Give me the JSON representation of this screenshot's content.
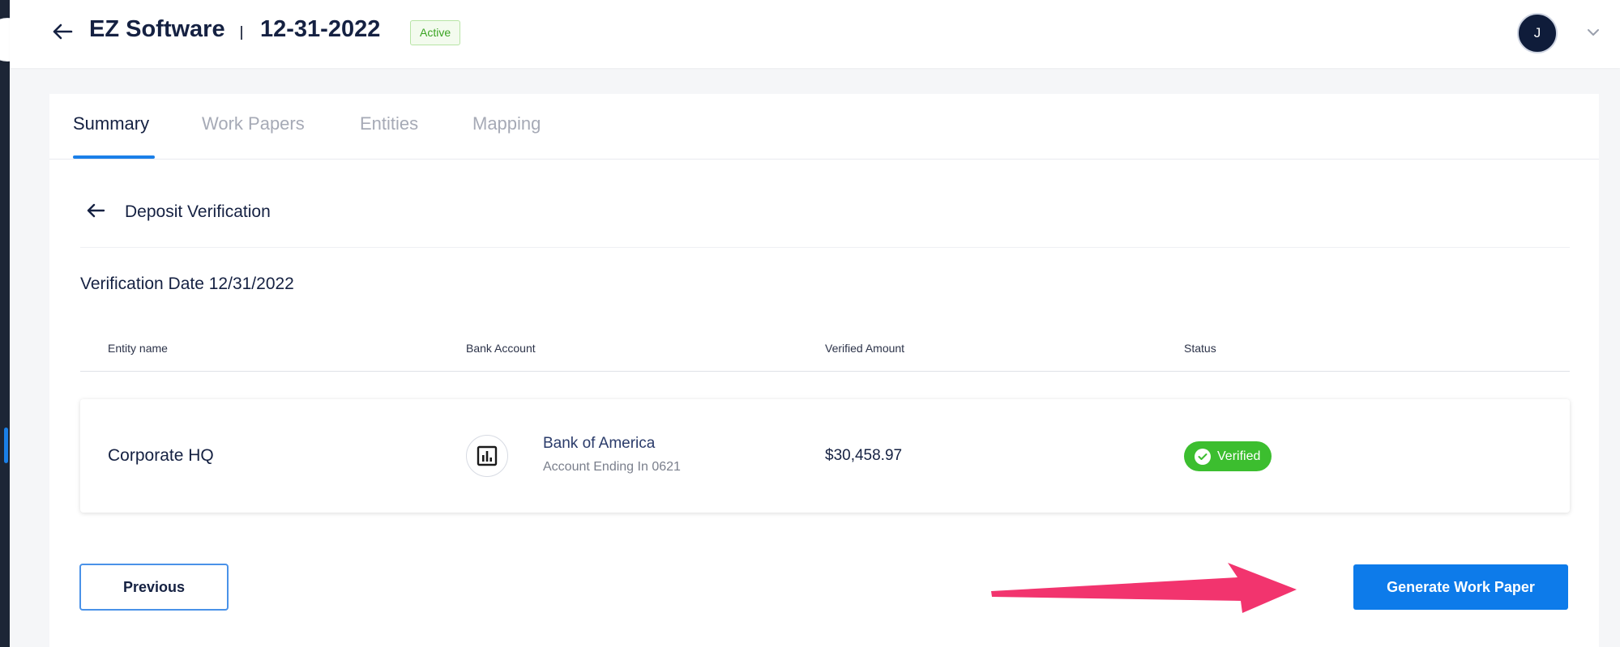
{
  "header": {
    "company": "EZ Software",
    "date": "12-31-2022",
    "status_badge": "Active",
    "avatar_initial": "J"
  },
  "tabs": [
    {
      "label": "Summary",
      "active": true
    },
    {
      "label": "Work Papers",
      "active": false
    },
    {
      "label": "Entities",
      "active": false
    },
    {
      "label": "Mapping",
      "active": false
    }
  ],
  "section": {
    "title": "Deposit Verification",
    "verification_date": "Verification Date 12/31/2022"
  },
  "table": {
    "columns": [
      "Entity name",
      "Bank Account",
      "Verified Amount",
      "Status"
    ],
    "rows": [
      {
        "entity": "Corporate HQ",
        "bank_name": "Bank of America",
        "bank_sub": "Account Ending In 0621",
        "bank_icon": "bar-chart-icon",
        "amount": "$30,458.97",
        "status": "Verified"
      }
    ]
  },
  "actions": {
    "previous_label": "Previous",
    "generate_label": "Generate Work Paper"
  },
  "colors": {
    "accent": "#0d7bea",
    "status_verified": "#3cbe2f",
    "annotation_arrow": "#f2346e"
  }
}
